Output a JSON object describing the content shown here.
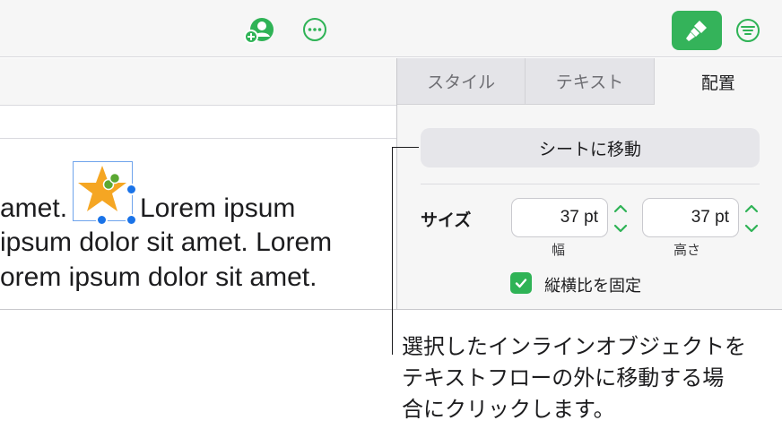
{
  "toolbar": {
    "icons": [
      "add-collaborator-icon",
      "more-icon",
      "format-brush-icon",
      "view-options-icon"
    ],
    "accent_color": "#34b35a"
  },
  "document": {
    "line1_a": "amet.",
    "line1_b": "Lorem ipsum",
    "line2": "ipsum dolor sit amet. Lorem",
    "line3": "orem ipsum dolor sit amet."
  },
  "panel": {
    "tabs": [
      {
        "label": "スタイル",
        "active": false
      },
      {
        "label": "テキスト",
        "active": false
      },
      {
        "label": "配置",
        "active": true
      }
    ],
    "move_to_sheet_label": "シートに移動",
    "size_label": "サイズ",
    "width_value": "37 pt",
    "height_value": "37 pt",
    "width_caption": "幅",
    "height_caption": "高さ",
    "constrain_label": "縦横比を固定",
    "constrain_checked": true
  },
  "callout": {
    "line1": "選択したインラインオブジェクトを",
    "line2": "テキストフローの外に移動する場",
    "line3": "合にクリックします。"
  }
}
